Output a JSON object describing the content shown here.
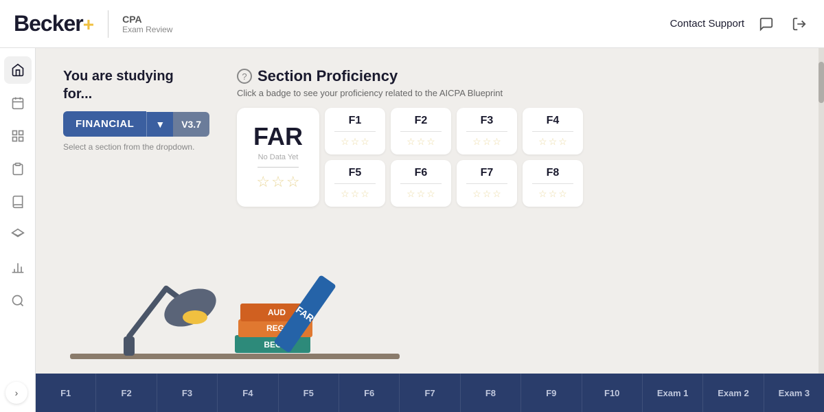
{
  "header": {
    "logo": "Becker",
    "logo_plus": "+",
    "cpa": "CPA",
    "exam_review": "Exam Review",
    "contact_support": "Contact Support"
  },
  "sidebar": {
    "items": [
      {
        "name": "home",
        "icon": "⌂",
        "active": true
      },
      {
        "name": "calendar",
        "icon": "▦"
      },
      {
        "name": "grid",
        "icon": "⊞"
      },
      {
        "name": "clipboard",
        "icon": "📋"
      },
      {
        "name": "book",
        "icon": "📖"
      },
      {
        "name": "layers",
        "icon": "◫"
      },
      {
        "name": "chart",
        "icon": "▯"
      },
      {
        "name": "search",
        "icon": "🔍"
      }
    ]
  },
  "main": {
    "studying_label_line1": "You are studying",
    "studying_label_line2": "for...",
    "section_name": "FINANCIAL",
    "section_version": "V3.7",
    "section_hint": "Select a section from the dropdown.",
    "proficiency_title": "Section Proficiency",
    "proficiency_subtitle": "Click a badge to see your proficiency related to the AICPA Blueprint",
    "far_label": "FAR",
    "far_no_data": "No Data Yet",
    "badges": [
      {
        "id": "F1",
        "stars": 3
      },
      {
        "id": "F2",
        "stars": 3
      },
      {
        "id": "F3",
        "stars": 3
      },
      {
        "id": "F4",
        "stars": 3
      },
      {
        "id": "F5",
        "stars": 3
      },
      {
        "id": "F6",
        "stars": 3
      },
      {
        "id": "F7",
        "stars": 3
      },
      {
        "id": "F8",
        "stars": 3
      }
    ],
    "tabs": [
      "F1",
      "F2",
      "F3",
      "F4",
      "F5",
      "F6",
      "F7",
      "F8",
      "F9",
      "F10",
      "Exam 1",
      "Exam 2",
      "Exam 3"
    ]
  },
  "colors": {
    "primary_blue": "#3b5fa0",
    "dark_blue": "#2a3d6b",
    "star_gold": "#d4af37",
    "bg": "#f0eeeb"
  }
}
